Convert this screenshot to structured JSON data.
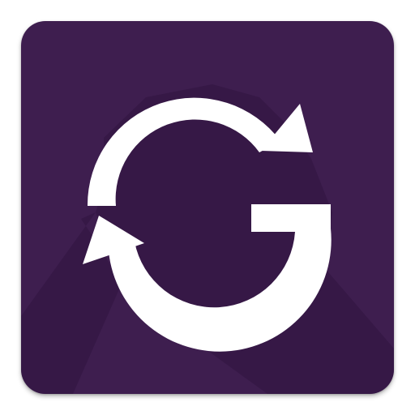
{
  "app_icon": {
    "name": "sync-g-app-icon",
    "glyph": "refresh-arrows-letter-g",
    "colors": {
      "background": "#3e1e4f",
      "long_shadow": "#2f1440",
      "glyph": "#ffffff"
    }
  }
}
